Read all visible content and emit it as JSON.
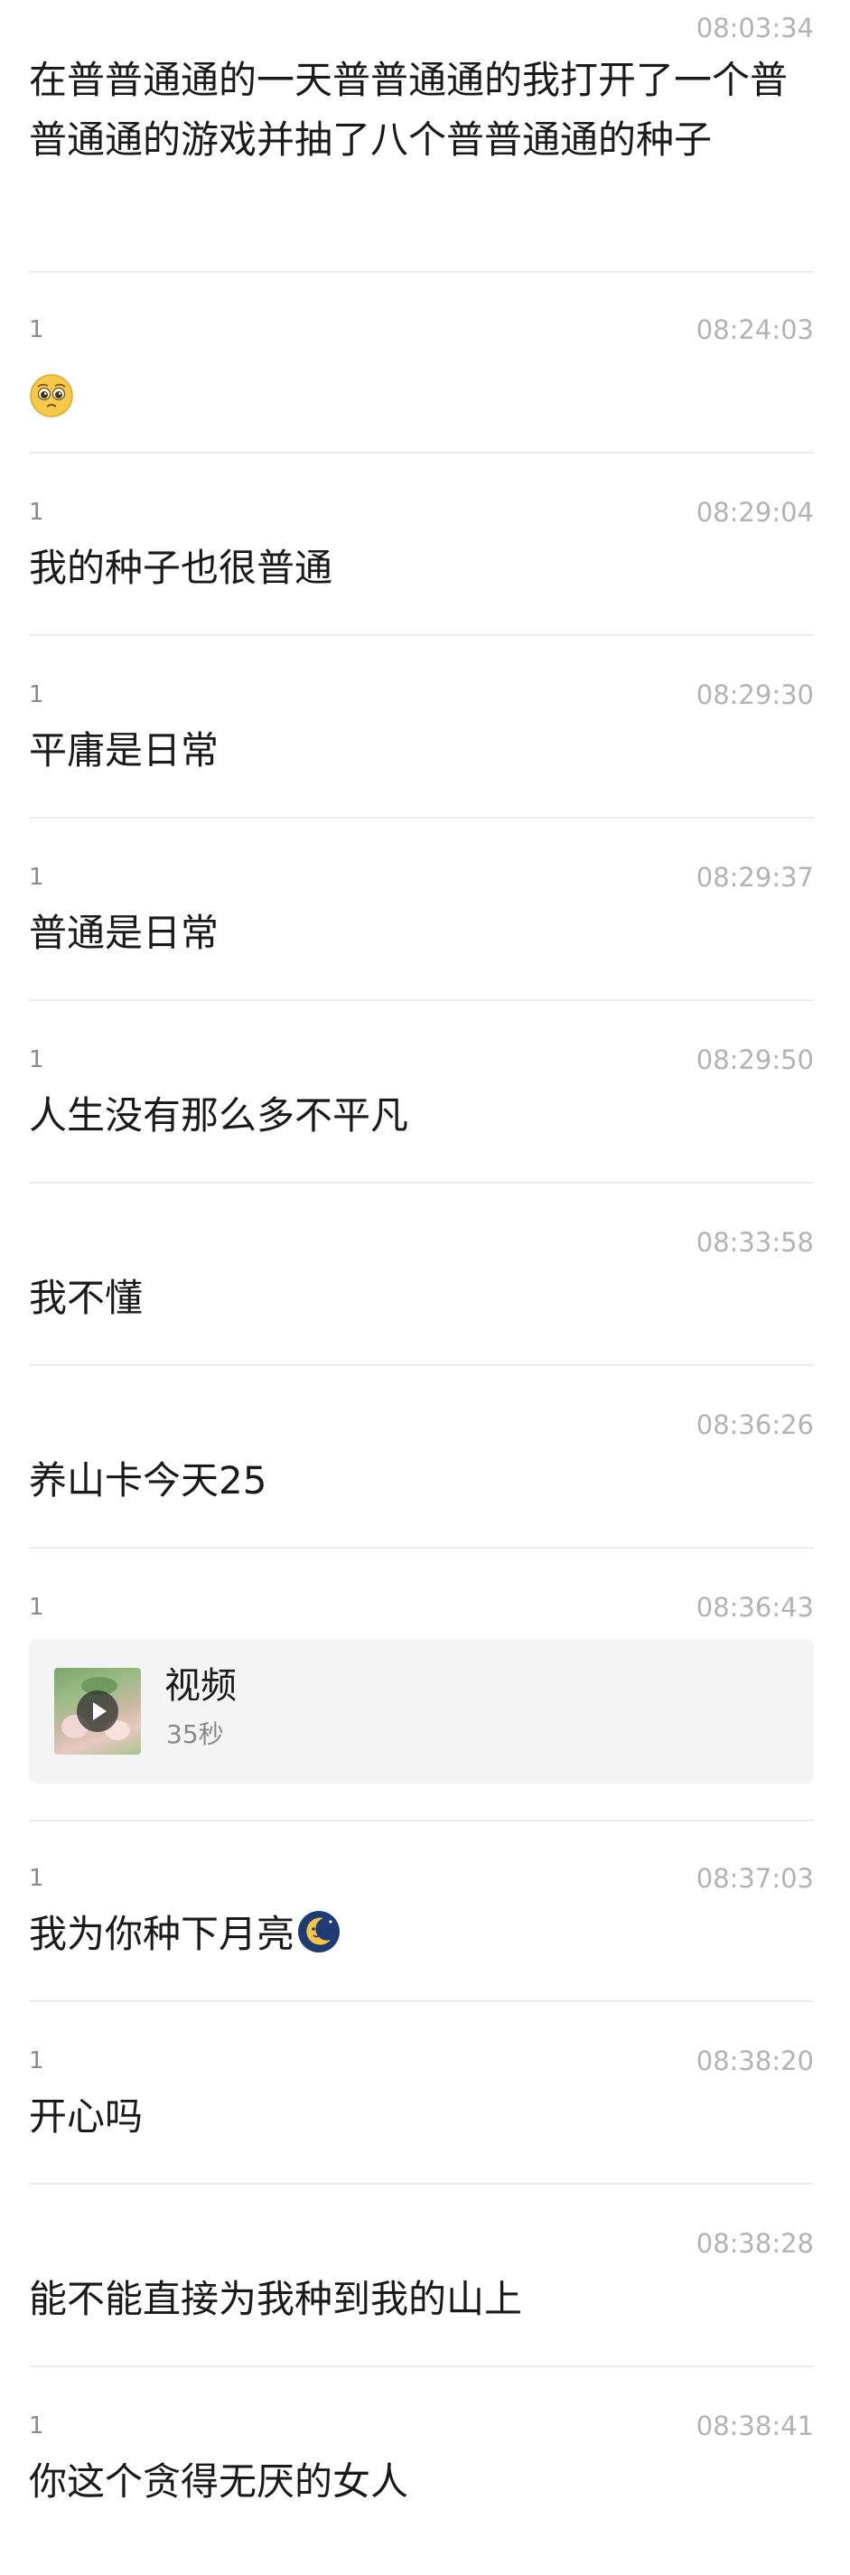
{
  "messages": [
    {
      "sender": "",
      "time": "08:03:34",
      "text": "在普普通通的一天普普通通的我打开了一个普普通通的游戏并抽了八个普普通通的种子"
    },
    {
      "sender": "1",
      "time": "08:24:03",
      "text": "",
      "emoji": "pleading-face-icon"
    },
    {
      "sender": "1",
      "time": "08:29:04",
      "text": "我的种子也很普通"
    },
    {
      "sender": "1",
      "time": "08:29:30",
      "text": "平庸是日常"
    },
    {
      "sender": "1",
      "time": "08:29:37",
      "text": "普通是日常"
    },
    {
      "sender": "1",
      "time": "08:29:50",
      "text": "人生没有那么多不平凡"
    },
    {
      "sender": "",
      "time": "08:33:58",
      "text": "我不懂"
    },
    {
      "sender": "",
      "time": "08:36:26",
      "text": "养山卡今天25"
    },
    {
      "sender": "1",
      "time": "08:36:43",
      "video": {
        "title": "视频",
        "duration": "35秒"
      }
    },
    {
      "sender": "1",
      "time": "08:37:03",
      "text": "我为你种下月亮",
      "emoji": "moon-icon"
    },
    {
      "sender": "1",
      "time": "08:38:20",
      "text": "开心吗"
    },
    {
      "sender": "",
      "time": "08:38:28",
      "text": "能不能直接为我种到我的山上"
    },
    {
      "sender": "1",
      "time": "08:38:41",
      "text": "你这个贪得无厌的女人"
    }
  ]
}
